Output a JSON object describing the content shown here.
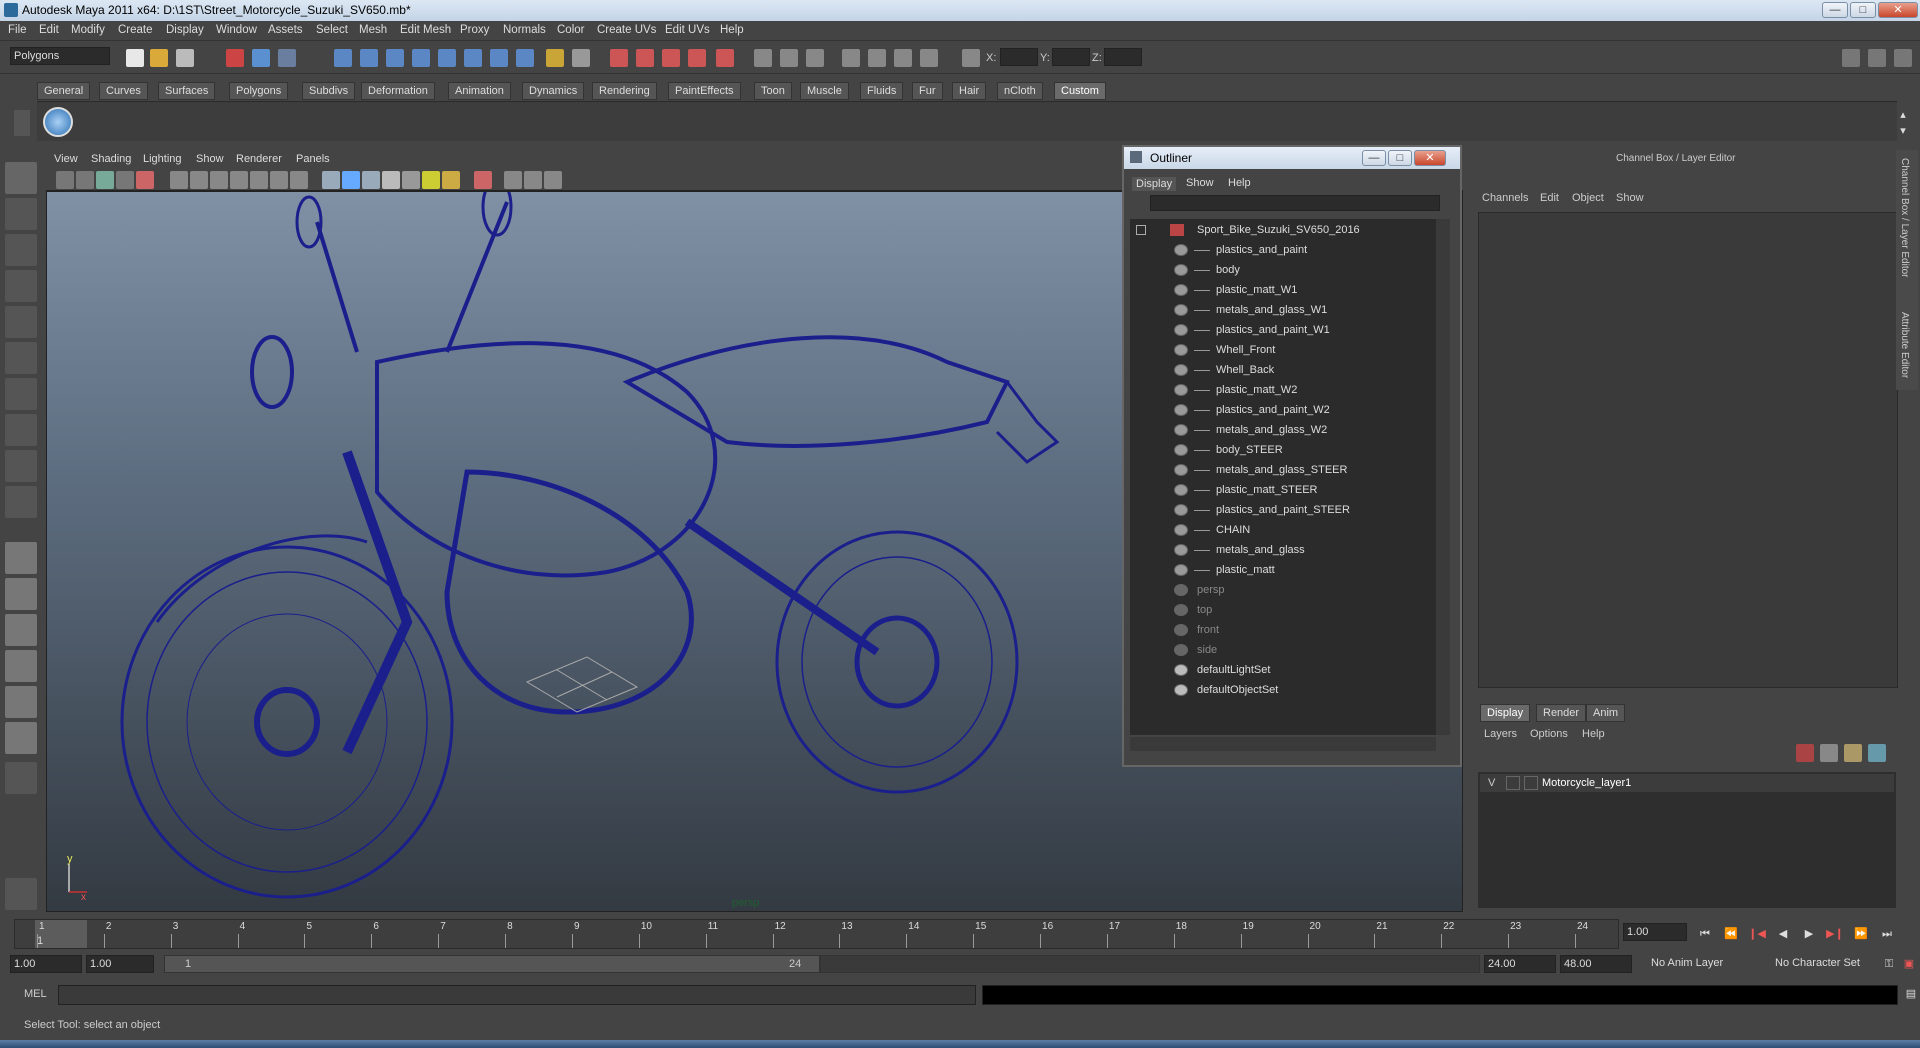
{
  "window": {
    "title": "Autodesk Maya 2011 x64: D:\\1ST\\Street_Motorcycle_Suzuki_SV650.mb*",
    "minimize": "—",
    "maximize": "□",
    "close": "✕"
  },
  "menubar": [
    "File",
    "Edit",
    "Modify",
    "Create",
    "Display",
    "Window",
    "Assets",
    "Select",
    "Mesh",
    "Edit Mesh",
    "Proxy",
    "Normals",
    "Color",
    "Create UVs",
    "Edit UVs",
    "Help"
  ],
  "status": {
    "mode": "Polygons",
    "x_label": "X:",
    "y_label": "Y:",
    "z_label": "Z:"
  },
  "shelf_tabs": [
    "General",
    "Curves",
    "Surfaces",
    "Polygons",
    "Subdivs",
    "Deformation",
    "Animation",
    "Dynamics",
    "Rendering",
    "PaintEffects",
    "Toon",
    "Muscle",
    "Fluids",
    "Fur",
    "Hair",
    "nCloth",
    "Custom"
  ],
  "shelf_active": "Custom",
  "viewport": {
    "menu": [
      "View",
      "Shading",
      "Lighting",
      "Show",
      "Renderer",
      "Panels"
    ],
    "camera_label": "persp",
    "axis_y": "y",
    "axis_x": "x",
    "wire_color": "#1a1f8c"
  },
  "outliner": {
    "title": "Outliner",
    "menu": [
      "Display",
      "Show",
      "Help"
    ],
    "root": "Sport_Bike_Suzuki_SV650_2016",
    "children": [
      "plastics_and_paint",
      "body",
      "plastic_matt_W1",
      "metals_and_glass_W1",
      "plastics_and_paint_W1",
      "Whell_Front",
      "Whell_Back",
      "plastic_matt_W2",
      "plastics_and_paint_W2",
      "metals_and_glass_W2",
      "body_STEER",
      "metals_and_glass_STEER",
      "plastic_matt_STEER",
      "plastics_and_paint_STEER",
      "CHAIN",
      "metals_and_glass",
      "plastic_matt"
    ],
    "cameras": [
      "persp",
      "top",
      "front",
      "side"
    ],
    "sets": [
      "defaultLightSet",
      "defaultObjectSet"
    ]
  },
  "channelbox": {
    "title": "Channel Box / Layer Editor",
    "menu": [
      "Channels",
      "Edit",
      "Object",
      "Show"
    ],
    "side_tabs": [
      "Channel Box / Layer Editor",
      "Attribute Editor"
    ]
  },
  "layers": {
    "tabs": [
      "Display",
      "Render",
      "Anim"
    ],
    "menu": [
      "Layers",
      "Options",
      "Help"
    ],
    "visible_flag": "V",
    "layer_name": "Motorcycle_layer1"
  },
  "timeline": {
    "ticks": [
      "1",
      "2",
      "3",
      "4",
      "5",
      "6",
      "7",
      "8",
      "9",
      "10",
      "11",
      "12",
      "13",
      "14",
      "15",
      "16",
      "17",
      "18",
      "19",
      "20",
      "21",
      "22",
      "23",
      "24"
    ],
    "current_marker": "1",
    "current_frame": "1.00"
  },
  "range": {
    "start": "1.00",
    "playback_start": "1.00",
    "slider_start": "1",
    "slider_end": "24",
    "playback_end": "24.00",
    "end": "48.00",
    "anim_layer": "No Anim Layer",
    "character_set": "No Character Set"
  },
  "cmd": {
    "label": "MEL"
  },
  "help": "Select Tool: select an object"
}
